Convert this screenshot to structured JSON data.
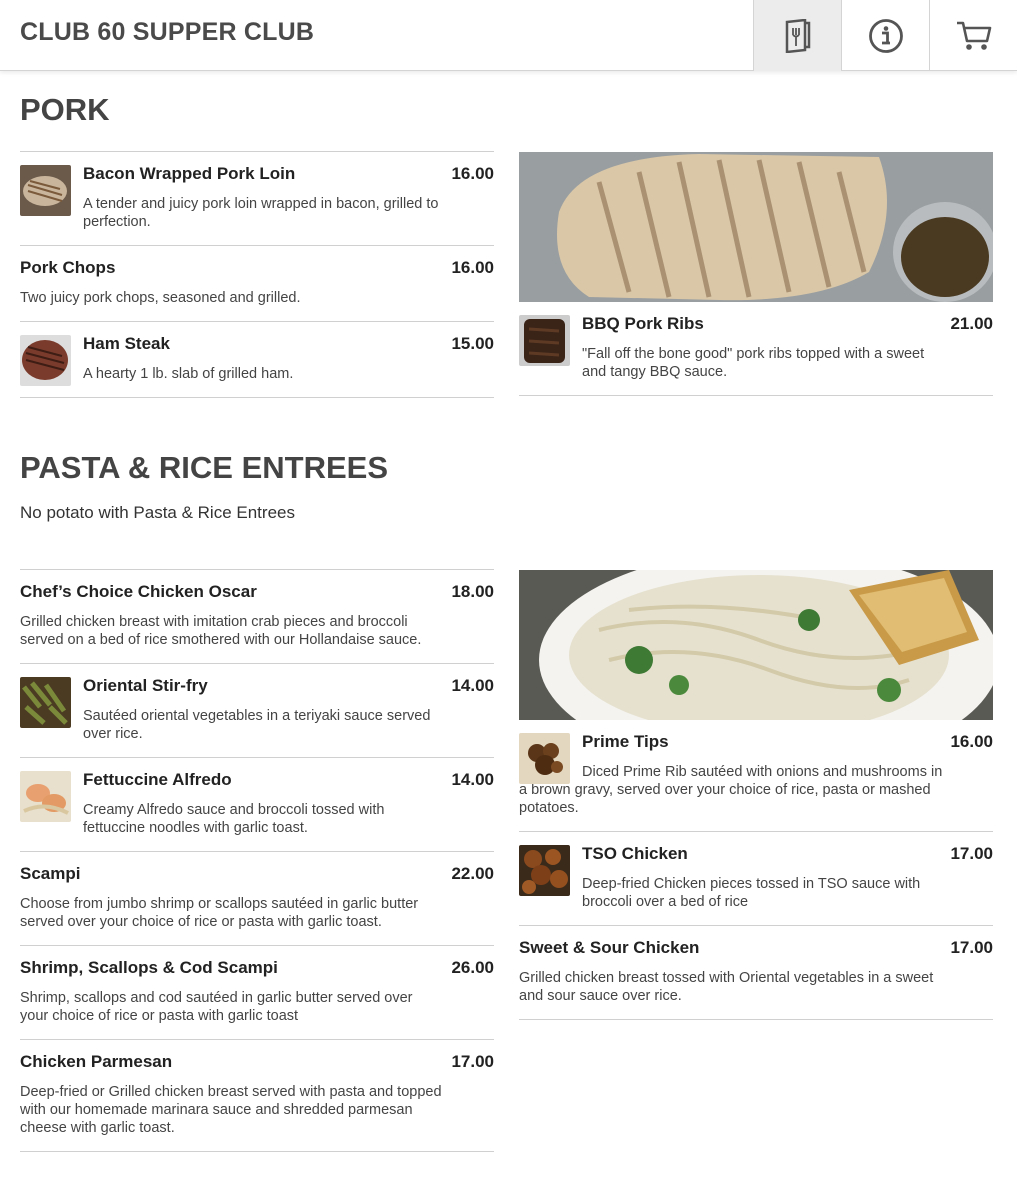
{
  "header": {
    "brand": "CLUB 60 SUPPER CLUB",
    "nav": [
      "menu-icon",
      "info-icon",
      "cart-icon"
    ]
  },
  "sections": {
    "pork": {
      "title": "PORK",
      "left": [
        {
          "name": "Bacon Wrapped Pork Loin",
          "price": "16.00",
          "desc": "A tender and juicy pork loin wrapped in bacon, grilled to perfection."
        },
        {
          "name": "Pork Chops",
          "price": "16.00",
          "desc": "Two juicy pork chops, seasoned and grilled."
        },
        {
          "name": "Ham Steak",
          "price": "15.00",
          "desc": "A hearty 1 lb. slab of grilled ham."
        }
      ],
      "right": [
        {
          "name": "BBQ Pork Ribs",
          "price": "21.00",
          "desc": "\"Fall off the bone good\" pork ribs topped with a sweet and tangy BBQ sauce."
        }
      ]
    },
    "pasta": {
      "title": "PASTA & RICE ENTREES",
      "note": "No potato with Pasta & Rice Entrees",
      "left": [
        {
          "name": "Chef’s Choice Chicken Oscar",
          "price": "18.00",
          "desc": "Grilled chicken breast with imitation crab pieces and broccoli served on a bed of rice smothered with our Hollandaise sauce."
        },
        {
          "name": "Oriental Stir-fry",
          "price": "14.00",
          "desc": "Sautéed oriental vegetables in a teriyaki sauce served over rice."
        },
        {
          "name": "Fettuccine Alfredo",
          "price": "14.00",
          "desc": "Creamy Alfredo sauce and broccoli tossed with fettuccine noodles with garlic toast."
        },
        {
          "name": "Scampi",
          "price": "22.00",
          "desc": "Choose from jumbo shrimp or scallops sautéed in garlic butter served over your choice of rice or pasta with garlic toast."
        },
        {
          "name": "Shrimp, Scallops & Cod Scampi",
          "price": "26.00",
          "desc": "Shrimp, scallops and cod sautéed in garlic butter served over your choice of rice or pasta with garlic toast"
        },
        {
          "name": "Chicken Parmesan",
          "price": "17.00",
          "desc": "Deep-fried or Grilled chicken breast served with pasta and topped with our homemade marinara sauce and shredded parmesan cheese with garlic toast."
        }
      ],
      "right": [
        {
          "name": "Prime Tips",
          "price": "16.00",
          "desc": "Diced Prime Rib sautéed with onions and mushrooms in a brown gravy, served over your choice of rice, pasta or mashed potatoes."
        },
        {
          "name": "TSO Chicken",
          "price": "17.00",
          "desc": "Deep-fried Chicken pieces tossed in TSO sauce with broccoli over a bed of rice"
        },
        {
          "name": "Sweet & Sour Chicken",
          "price": "17.00",
          "desc": "Grilled chicken breast tossed with Oriental vegetables in a sweet and sour sauce over rice."
        }
      ]
    }
  }
}
